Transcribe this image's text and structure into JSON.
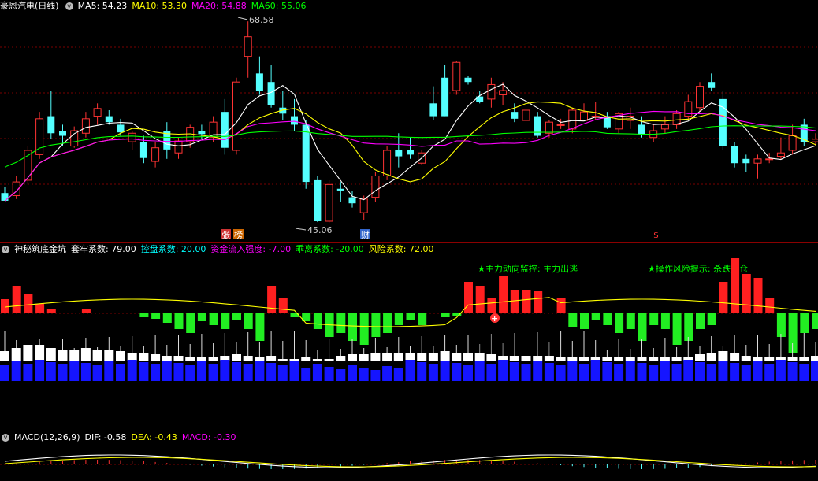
{
  "panel1": {
    "title": "豪恩汽电(日线)",
    "ma": [
      {
        "label": "MA5: 54.23",
        "color": "#ffffff"
      },
      {
        "label": "MA10: 53.30",
        "color": "#ffff00"
      },
      {
        "label": "MA20: 54.88",
        "color": "#ff00ff"
      },
      {
        "label": "MA60: 55.06",
        "color": "#00ff00"
      }
    ],
    "high_label": "68.58",
    "low_label": "45.06",
    "markers": [
      {
        "text": "张",
        "color": "#ffffff",
        "bg": "#cc3333"
      },
      {
        "text": "榜",
        "color": "#ffffff",
        "bg": "#cc6600"
      },
      {
        "text": "财",
        "color": "#ffffff",
        "bg": "#3366cc"
      },
      {
        "text": "$",
        "color": "#ff3333",
        "bg": "none"
      }
    ]
  },
  "panel2": {
    "title": "神秘筑底金坑",
    "items": [
      {
        "label": "套牢系数: 79.00",
        "color": "#ffffff"
      },
      {
        "label": "控盘系数: 20.00",
        "color": "#00ffff"
      },
      {
        "label": "资金流入强度: -7.00",
        "color": "#ff00ff"
      },
      {
        "label": "乖离系数: -20.00",
        "color": "#00ff00"
      },
      {
        "label": "风险系数: 72.00",
        "color": "#ffff00"
      }
    ],
    "annotations": [
      {
        "text": "★主力动向监控: 主力出逃",
        "color": "#00ff00"
      },
      {
        "text": "★操作风险提示: 杀跌空仓",
        "color": "#00ff00"
      }
    ]
  },
  "panel3": {
    "title": "MACD(12,26,9)",
    "items": [
      {
        "label": "DIF: -0.58",
        "color": "#ffffff"
      },
      {
        "label": "DEA: -0.43",
        "color": "#ffff00"
      },
      {
        "label": "MACD: -0.30",
        "color": "#ff00ff"
      }
    ]
  },
  "colors": {
    "up": "#ff3333",
    "down": "#54ffff",
    "grid": "#7a0000",
    "bg": "#000000"
  },
  "chart_data": {
    "type": "candlestick",
    "price_range": [
      44,
      70
    ],
    "candles": [
      [
        48.5,
        49.2,
        47.6,
        47.6
      ],
      [
        48.2,
        50.5,
        47.8,
        49.8
      ],
      [
        50.0,
        54.0,
        49.5,
        53.5
      ],
      [
        53.0,
        58.0,
        52.5,
        57.2
      ],
      [
        57.5,
        60.5,
        54.8,
        55.5
      ],
      [
        55.8,
        56.5,
        54.0,
        55.2
      ],
      [
        54.0,
        56.3,
        53.8,
        55.8
      ],
      [
        55.5,
        58.0,
        55.0,
        57.2
      ],
      [
        57.5,
        59.0,
        56.5,
        58.4
      ],
      [
        57.5,
        58.2,
        56.5,
        56.8
      ],
      [
        56.5,
        57.2,
        55.2,
        55.6
      ],
      [
        54.5,
        55.8,
        53.5,
        55.5
      ],
      [
        54.5,
        55.2,
        52.0,
        52.6
      ],
      [
        52.2,
        54.5,
        51.5,
        53.8
      ],
      [
        55.8,
        56.8,
        52.5,
        53.6
      ],
      [
        53.2,
        55.0,
        52.5,
        54.6
      ],
      [
        54.5,
        56.5,
        53.8,
        56.2
      ],
      [
        55.8,
        56.5,
        54.8,
        55.4
      ],
      [
        55.0,
        57.5,
        54.5,
        56.8
      ],
      [
        58.0,
        59.5,
        53.0,
        53.8
      ],
      [
        53.5,
        62.0,
        53.0,
        61.5
      ],
      [
        64.5,
        68.6,
        62.0,
        66.8
      ],
      [
        62.5,
        64.5,
        60.0,
        60.5
      ],
      [
        61.5,
        63.5,
        58.5,
        58.8
      ],
      [
        58.5,
        60.5,
        57.0,
        57.8
      ],
      [
        57.5,
        59.5,
        55.8,
        56.5
      ],
      [
        56.5,
        57.0,
        49.0,
        49.8
      ],
      [
        50.0,
        50.5,
        45.1,
        45.2
      ],
      [
        45.2,
        50.0,
        45.0,
        49.5
      ],
      [
        49.0,
        49.8,
        47.5,
        48.8
      ],
      [
        48.0,
        48.8,
        46.8,
        47.3
      ],
      [
        46.2,
        48.2,
        45.3,
        47.8
      ],
      [
        48.0,
        51.0,
        47.5,
        50.5
      ],
      [
        50.5,
        54.0,
        50.0,
        53.5
      ],
      [
        53.5,
        55.5,
        51.5,
        52.8
      ],
      [
        53.5,
        55.0,
        52.5,
        53.0
      ],
      [
        52.0,
        53.5,
        51.8,
        53.2
      ],
      [
        59.0,
        61.0,
        57.0,
        57.5
      ],
      [
        62.0,
        63.5,
        57.5,
        57.5
      ],
      [
        60.5,
        64.0,
        60.0,
        63.8
      ],
      [
        62.0,
        62.2,
        61.2,
        61.5
      ],
      [
        59.8,
        60.5,
        59.0,
        59.2
      ],
      [
        59.5,
        62.0,
        58.5,
        61.2
      ],
      [
        60.0,
        61.5,
        58.8,
        60.5
      ],
      [
        58.0,
        59.0,
        56.8,
        57.2
      ],
      [
        57.0,
        58.5,
        56.5,
        58.2
      ],
      [
        57.5,
        58.0,
        55.0,
        55.2
      ],
      [
        55.5,
        57.0,
        55.0,
        56.8
      ],
      [
        56.5,
        57.2,
        56.0,
        56.5
      ],
      [
        56.0,
        58.5,
        55.5,
        58.2
      ],
      [
        57.0,
        59.0,
        57.0,
        58.0
      ],
      [
        57.5,
        59.2,
        57.0,
        57.5
      ],
      [
        57.5,
        58.0,
        56.0,
        56.2
      ],
      [
        56.0,
        58.0,
        55.5,
        57.8
      ],
      [
        57.0,
        58.5,
        56.0,
        57.5
      ],
      [
        56.5,
        57.5,
        55.0,
        55.3
      ],
      [
        55.0,
        56.5,
        54.5,
        55.8
      ],
      [
        56.0,
        57.5,
        55.5,
        56.5
      ],
      [
        56.5,
        58.2,
        56.0,
        57.8
      ],
      [
        57.5,
        60.0,
        57.0,
        59.2
      ],
      [
        58.5,
        61.5,
        58.0,
        61.0
      ],
      [
        61.5,
        62.5,
        60.5,
        60.8
      ],
      [
        59.5,
        60.5,
        53.5,
        54.0
      ],
      [
        54.0,
        54.5,
        51.5,
        52.0
      ],
      [
        52.5,
        53.0,
        51.0,
        52.0
      ],
      [
        52.0,
        53.0,
        50.2,
        52.5
      ],
      [
        52.5,
        53.2,
        52.0,
        52.5
      ],
      [
        52.8,
        55.0,
        52.5,
        53.2
      ],
      [
        53.5,
        56.5,
        53.0,
        55.2
      ],
      [
        56.5,
        57.2,
        54.0,
        54.5
      ],
      [
        54.5,
        55.5,
        54.0,
        54.8
      ]
    ],
    "ma5_label": "MA5",
    "ma10_label": "MA10",
    "ma20_label": "MA20",
    "ma60_label": "MA60"
  }
}
